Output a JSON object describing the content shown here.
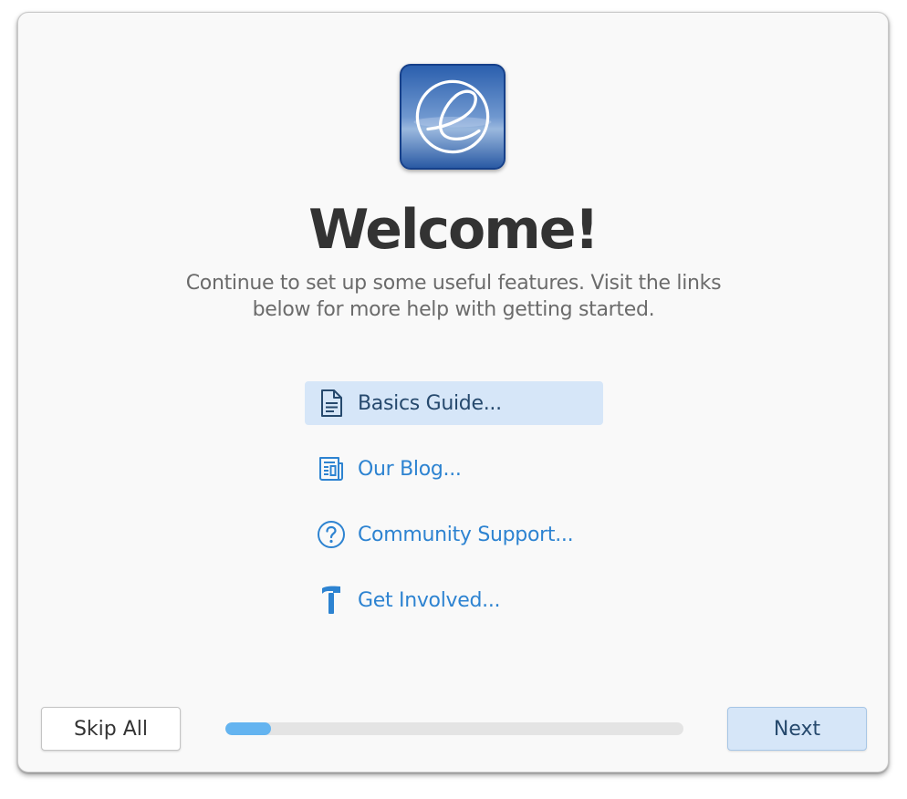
{
  "app": {
    "icon": "elementary-logo-icon"
  },
  "header": {
    "title": "Welcome!",
    "subtitle": "Continue to set up some useful features. Visit the links below for more help with getting started."
  },
  "links": [
    {
      "label": "Basics Guide...",
      "icon": "document-icon",
      "active": true
    },
    {
      "label": "Our Blog...",
      "icon": "newspaper-icon",
      "active": false
    },
    {
      "label": "Community Support...",
      "icon": "help-circle-icon",
      "active": false
    },
    {
      "label": "Get Involved...",
      "icon": "hammer-icon",
      "active": false
    }
  ],
  "footer": {
    "skip_label": "Skip All",
    "next_label": "Next",
    "progress": 0.1
  },
  "colors": {
    "accent": "#2d83d1",
    "active_row": "#d6e6f8",
    "progress_fill": "#64b4f0",
    "progress_track": "#e4e4e4"
  }
}
